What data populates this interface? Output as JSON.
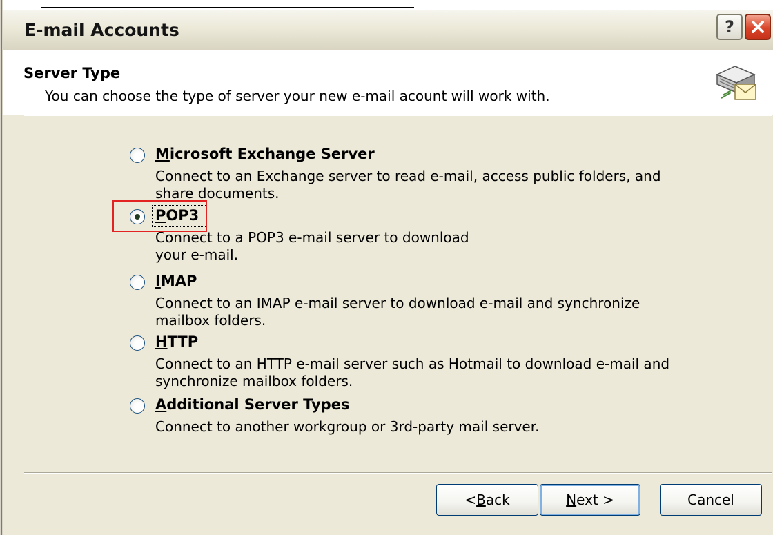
{
  "window": {
    "title": "E-mail Accounts"
  },
  "header": {
    "title": "Server Type",
    "description": "You can choose the type of server your new e-mail acount will work with."
  },
  "options": [
    {
      "label_key": "M",
      "label_rest": "icrosoft Exchange Server",
      "selected": false,
      "desc": [
        "Connect to an Exchange server to read e-mail, access public folders, and",
        "share documents."
      ]
    },
    {
      "label_key": "P",
      "label_rest": "OP3",
      "selected": true,
      "desc": [
        "Connect to a POP3 e-mail server to download",
        "your e-mail."
      ]
    },
    {
      "label_key": "I",
      "label_rest": "MAP",
      "selected": false,
      "desc": [
        "Connect to an IMAP e-mail server to download e-mail and synchronize",
        "mailbox folders."
      ]
    },
    {
      "label_key": "H",
      "label_rest": "TTP",
      "selected": false,
      "desc": [
        "Connect to an HTTP e-mail server such as Hotmail to download e-mail and",
        "synchronize mailbox folders."
      ]
    },
    {
      "label_key": "A",
      "label_rest": "dditional Server Types",
      "selected": false,
      "desc": [
        "Connect to another workgroup or 3rd-party mail server."
      ]
    }
  ],
  "buttons": {
    "back": {
      "prefix": "< ",
      "key": "B",
      "rest": "ack"
    },
    "next": {
      "key": "N",
      "rest": "ext >"
    },
    "cancel": "Cancel"
  },
  "colors": {
    "highlight": "#e32222",
    "face": "#ece9d8",
    "close": "#d8452a"
  },
  "icons": {
    "help": "?",
    "close": "close-icon",
    "header": "mail-server-icon"
  }
}
